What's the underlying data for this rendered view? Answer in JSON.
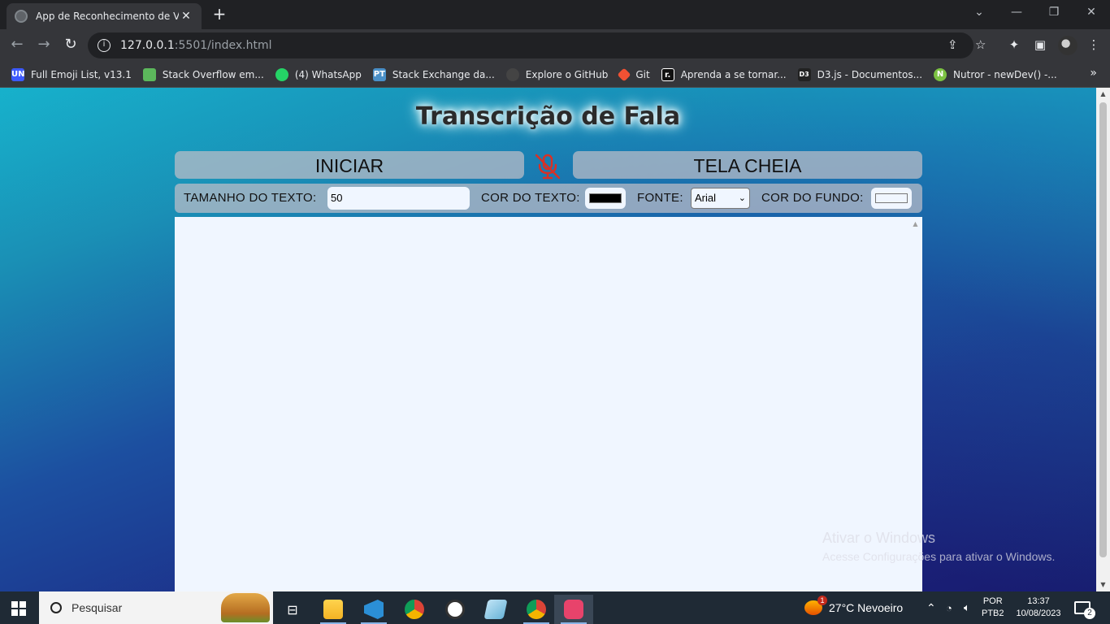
{
  "browser": {
    "tab_title": "App de Reconhecimento de Voz",
    "tab_close": "✕",
    "new_tab": "+",
    "url_host": "127.0.0.1",
    "url_rest": ":5501/index.html",
    "bookmarks": [
      {
        "label": "Full Emoji List, v13.1",
        "icon_text": "UN",
        "color": "#3d5afe"
      },
      {
        "label": "Stack Overflow em...",
        "icon_text": "",
        "color": "#5cb85c"
      },
      {
        "label": "(4) WhatsApp",
        "icon_text": "",
        "color": "#25d366"
      },
      {
        "label": "Stack Exchange da...",
        "icon_text": "PT",
        "color": "#4a90c8"
      },
      {
        "label": "Explore o GitHub",
        "icon_text": "",
        "color": "#444444"
      },
      {
        "label": "Git",
        "icon_text": "",
        "color": "#f05133"
      },
      {
        "label": "Aprenda a se tornar...",
        "icon_text": "r.",
        "color": "#111111"
      },
      {
        "label": "D3.js - Documentos...",
        "icon_text": "D3",
        "color": "#222222"
      },
      {
        "label": "Nutror - newDev() -...",
        "icon_text": "N",
        "color": "#7cc242"
      }
    ]
  },
  "app": {
    "title": "Transcrição de Fala",
    "start_button": "INICIAR",
    "fullscreen_button": "TELA CHEIA",
    "size_label": "TAMANHO DO TEXTO:",
    "size_value": "50",
    "text_color_label": "COR DO TEXTO:",
    "text_color": "#000000",
    "font_label": "FONTE:",
    "font_value": "Arial",
    "bg_color_label": "COR DO FUNDO:",
    "bg_color": "#f0f6ff",
    "mic_color": "#d93025"
  },
  "watermark": {
    "line1": "Ativar o Windows",
    "line2": "Acesse Configurações para ativar o Windows."
  },
  "taskbar": {
    "search_placeholder": "Pesquisar",
    "weather": "27°C  Nevoeiro",
    "language_line1": "POR",
    "language_line2": "PTB2",
    "time": "13:37",
    "date": "10/08/2023",
    "notification_count": "2",
    "weather_badge": "1"
  }
}
